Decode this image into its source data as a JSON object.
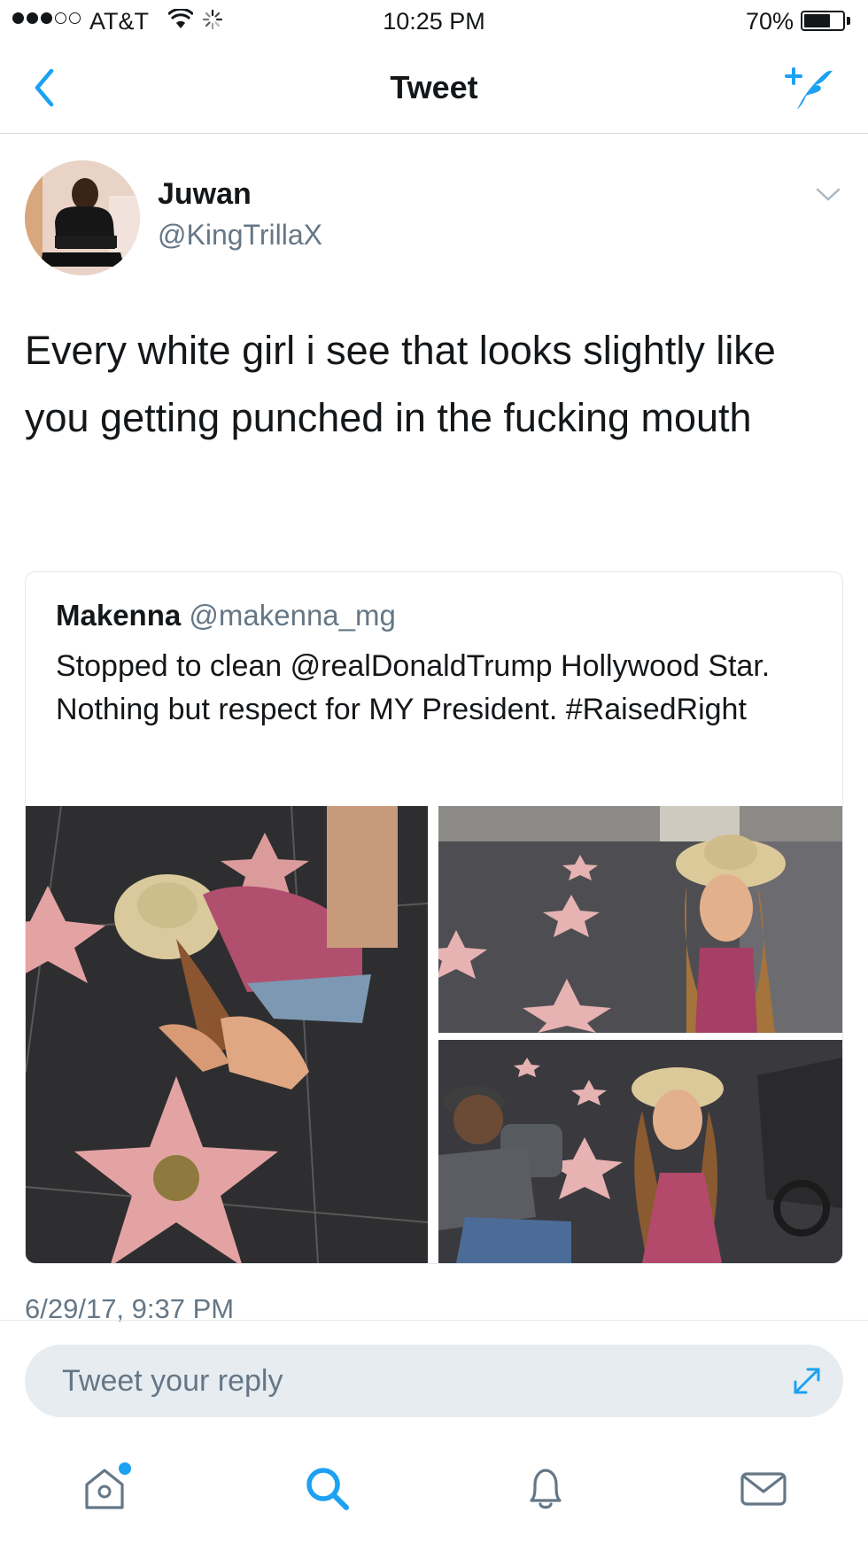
{
  "status_bar": {
    "carrier": "AT&T",
    "time": "10:25 PM",
    "battery_percent": "70%",
    "battery_level": 0.7,
    "signal_bars_filled": 3,
    "signal_bars_total": 5
  },
  "nav": {
    "title": "Tweet",
    "back_icon": "chevron-left-icon",
    "compose_icon": "compose-tweet-icon"
  },
  "tweet": {
    "author_name": "Juwan",
    "author_handle": "@KingTrillaX",
    "text": "Every white girl i see that looks slightly like you getting punched in the fucking mouth",
    "timestamp": "6/29/17, 9:37 PM"
  },
  "quoted_tweet": {
    "author_name": "Makenna",
    "author_handle": "@makenna_mg",
    "text": "Stopped to clean @realDonaldTrump Hollywood Star. Nothing but respect for MY President. #RaisedRight",
    "photo_count": 3
  },
  "reply": {
    "placeholder": "Tweet your reply"
  },
  "tab_bar": {
    "items": [
      "home-icon",
      "search-icon",
      "notifications-icon",
      "messages-icon"
    ]
  },
  "colors": {
    "accent": "#1da1f2",
    "text": "#14171a",
    "secondary": "#657786",
    "reply_bg": "#e6ecf0",
    "star_pink": "#e8a6a6"
  }
}
